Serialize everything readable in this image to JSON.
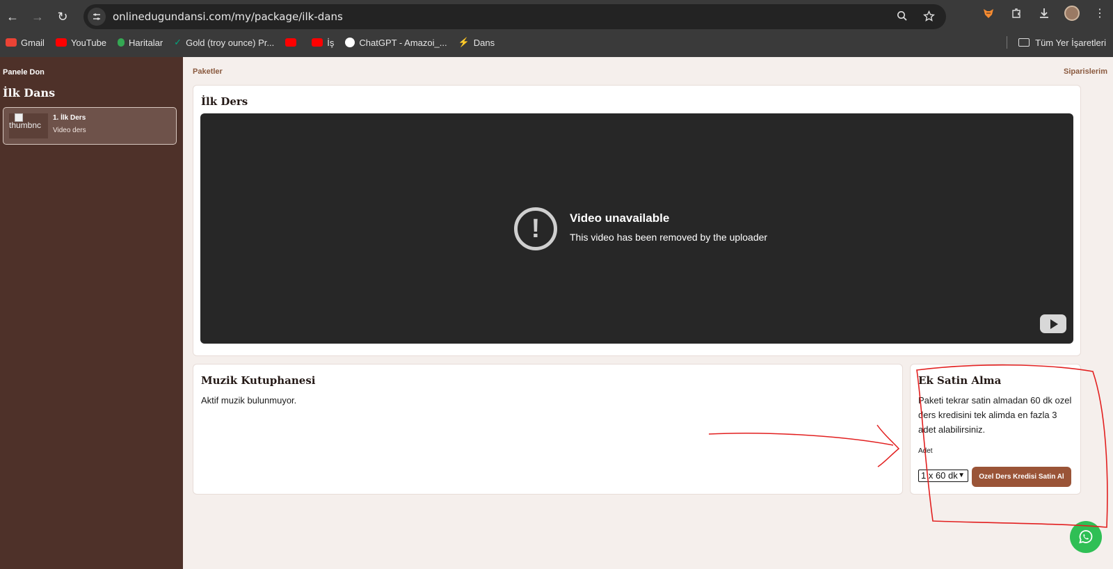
{
  "browser": {
    "url": "onlinedugundansi.com/my/package/ilk-dans",
    "back_icon": "←",
    "forward_icon": "→",
    "reload_icon": "↻",
    "bookmarks": [
      {
        "label": "Gmail",
        "color": "#ea4335"
      },
      {
        "label": "YouTube",
        "color": "#ff0000"
      },
      {
        "label": "Haritalar",
        "color": "#34a853"
      },
      {
        "label": "Gold (troy ounce) Pr...",
        "color": "#00a67e"
      },
      {
        "label": "",
        "color": "#ff0000"
      },
      {
        "label": "İş",
        "color": "#ff0000"
      },
      {
        "label": "ChatGPT - Amazoi_...",
        "color": "#ffffff"
      },
      {
        "label": "Dans",
        "color": "#8b5cf6"
      }
    ],
    "bookmarks_folder": "Tüm Yer İşaretleri"
  },
  "sidebar": {
    "back_label": "Panele Don",
    "package_title": "İlk Dans",
    "lesson": {
      "thumbnail_alt": "thumbnc",
      "title": "1. İlk Ders",
      "subtitle": "Video ders"
    }
  },
  "main": {
    "left_link": "Paketler",
    "right_link": "Siparislerim",
    "lesson_card": {
      "title": "İlk Ders",
      "video_title": "Video unavailable",
      "video_message": "This video has been removed by the uploader"
    },
    "music": {
      "title": "Muzik Kutuphanesi",
      "empty_text": "Aktif muzik bulunmuyor."
    },
    "purchase": {
      "title": "Ek Satin Alma",
      "description": "Paketi tekrar satin almadan 60 dk ozel ders kredisini tek alimda en fazla 3 adet alabilirsiniz.",
      "quantity_label": "Adet",
      "selected_quantity": "1 x 60 dk",
      "button_label": "Ozel Ders Kredisi Satin Al"
    }
  },
  "colors": {
    "sidebar": "#4e3129",
    "accent": "#9a5437",
    "annotation": "#e21f1f",
    "whatsapp": "#2fbf55"
  }
}
